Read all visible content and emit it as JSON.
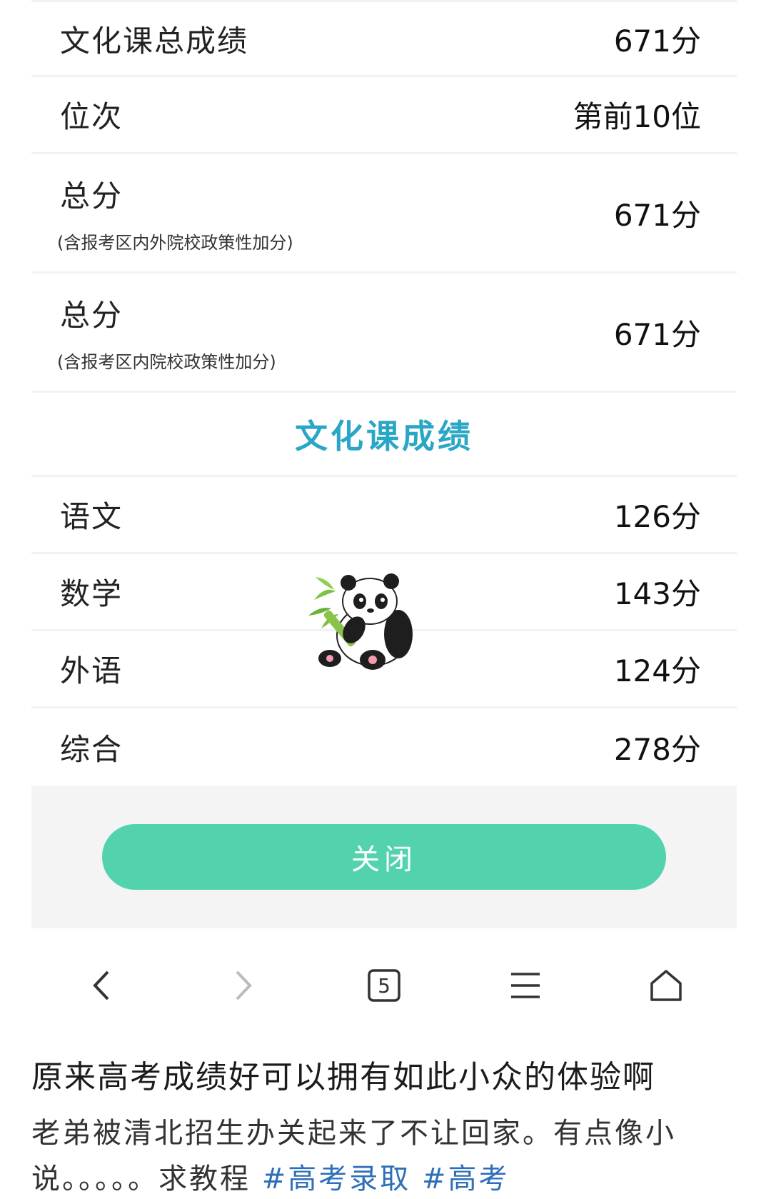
{
  "score_card": {
    "rows_top": [
      {
        "label": "文化课总成绩",
        "value": "671分"
      },
      {
        "label": "位次",
        "value": "第前10位"
      }
    ],
    "rows_total": [
      {
        "label": "总分",
        "note": "(含报考区内外院校政策性加分)",
        "value": "671分"
      },
      {
        "label": "总分",
        "note": "(含报考区内院校政策性加分)",
        "value": "671分"
      }
    ],
    "section_title": "文化课成绩",
    "subjects": [
      {
        "label": "语文",
        "value": "126分"
      },
      {
        "label": "数学",
        "value": "143分"
      },
      {
        "label": "外语",
        "value": "124分"
      },
      {
        "label": "综合",
        "value": "278分"
      }
    ],
    "close_label": "关闭"
  },
  "browser_nav": {
    "tab_count": "5",
    "icons": [
      "back-icon",
      "forward-icon",
      "tabs-icon",
      "menu-icon",
      "home-icon"
    ]
  },
  "post": {
    "title": "原来高考成绩好可以拥有如此小众的体验啊",
    "body": "老弟被清北招生办关起来了不让回家。有点像小说。。。。。求教程",
    "hashtags": [
      "#高考录取",
      "#高考"
    ]
  },
  "colors": {
    "accent_title": "#2aa6c6",
    "button": "#53d3ad",
    "hashtag": "#2d6fb8"
  }
}
